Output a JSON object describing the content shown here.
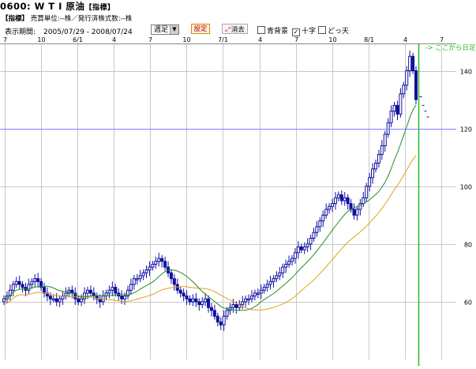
{
  "header": {
    "code_title": "0600: W T I 原油",
    "title_tag": "【指標】",
    "sub_tag": "【指標】",
    "sub_text": "売買単位:--株／発行済株式数:--株"
  },
  "period": {
    "label": "表示期間:",
    "range": "2005/07/29 - 2008/07/24"
  },
  "controls": {
    "period_select": "週足",
    "settings_button": "設定",
    "erase_button": "消去",
    "checkboxes": [
      {
        "label": "青背景",
        "checked": false
      },
      {
        "label": "十字",
        "checked": true
      },
      {
        "label": "どっ天",
        "checked": false
      }
    ]
  },
  "colors": {
    "up_candle": "#1010a0",
    "down_candle": "#1010a0",
    "ma_short": "#209020",
    "ma_long": "#e0a020",
    "crosshair": "#8080ff",
    "daily_marker": "#22bb22",
    "grid": "#c8c8c8"
  },
  "chart_data": {
    "type": "candlestick",
    "y_ticks": [
      60,
      80,
      100,
      120,
      140
    ],
    "ylim": [
      40,
      150
    ],
    "x_tick_labels": [
      "7",
      "10",
      "6/1",
      "4",
      "7",
      "10",
      "7/1",
      "4",
      "7",
      "10",
      "8/1",
      "4",
      "7"
    ],
    "daily_marker_label": "-> ここから日足",
    "crosshair_value": 120,
    "series": [
      {
        "name": "weekly_close",
        "values": [
          61,
          62,
          64,
          66,
          67,
          66,
          65,
          64,
          66,
          67,
          68,
          67,
          65,
          63,
          62,
          61,
          61,
          60,
          61,
          62,
          63,
          64,
          63,
          61,
          60,
          61,
          63,
          64,
          63,
          62,
          61,
          60,
          62,
          63,
          64,
          65,
          63,
          62,
          61,
          62,
          64,
          66,
          68,
          68,
          69,
          70,
          71,
          72,
          73,
          74,
          75,
          74,
          72,
          70,
          68,
          66,
          64,
          63,
          62,
          61,
          60,
          61,
          60,
          59,
          60,
          61,
          58,
          57,
          55,
          53,
          52,
          55,
          57,
          58,
          59,
          58,
          59,
          60,
          61,
          61,
          62,
          63,
          63,
          64,
          65,
          66,
          67,
          68,
          69,
          70,
          72,
          73,
          74,
          75,
          77,
          79,
          78,
          79,
          80,
          82,
          84,
          86,
          88,
          90,
          92,
          93,
          94,
          96,
          97,
          95,
          96,
          94,
          92,
          90,
          92,
          94,
          96,
          100,
          103,
          106,
          108,
          111,
          114,
          118,
          122,
          126,
          128,
          125,
          132,
          135,
          140,
          145,
          140,
          130
        ]
      }
    ],
    "ma_short_label": "",
    "ma_long_label": ""
  }
}
